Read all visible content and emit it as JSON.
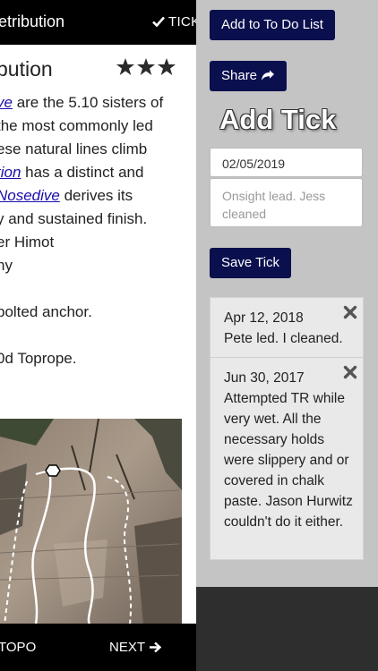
{
  "left_page": {
    "header_title": "etribution",
    "tick_label": "TICK",
    "route_title": "bution",
    "rating_stars": 3,
    "description_lines": {
      "l1_link": "ve",
      "l1_rest": " are the 5.10 sisters of",
      "l2": "the most commonly led",
      "l3": "ese natural lines climb",
      "l4_link": "tion",
      "l4_rest": " has a distinct and",
      "l5_link": "Nosedive",
      "l5_rest": " derives its",
      "l6": "y and sustained finish.",
      "l7": "er Himot",
      "l8": "hy",
      "l9": "bolted anchor.",
      "l10": "0d Toprope."
    },
    "topo_label": "TOPO",
    "next_label": "NEXT"
  },
  "panel": {
    "todo_button": "Add to To Do List",
    "share_button": "Share",
    "heading": "Add Tick",
    "date_value": "02/05/2019",
    "notes_placeholder": "Onsight lead. Jess cleaned",
    "save_button": "Save Tick",
    "ticks": [
      {
        "date": "Apr 12, 2018",
        "note": "Pete led. I cleaned."
      },
      {
        "date": "Jun 30, 2017",
        "note": "Attempted TR while very wet. All the necessary holds were slippery and or covered in chalk paste. Jason Hurwitz couldn't do it either."
      }
    ]
  },
  "colors": {
    "button_navy": "#0a0f4e",
    "panel_gray": "#c4c4c4",
    "link_blue": "#1a0dab",
    "bar_black": "#000000"
  },
  "icons": [
    "checkmark-icon",
    "star-icon",
    "share-arrow-icon",
    "close-x-icon",
    "arrow-right-icon"
  ]
}
